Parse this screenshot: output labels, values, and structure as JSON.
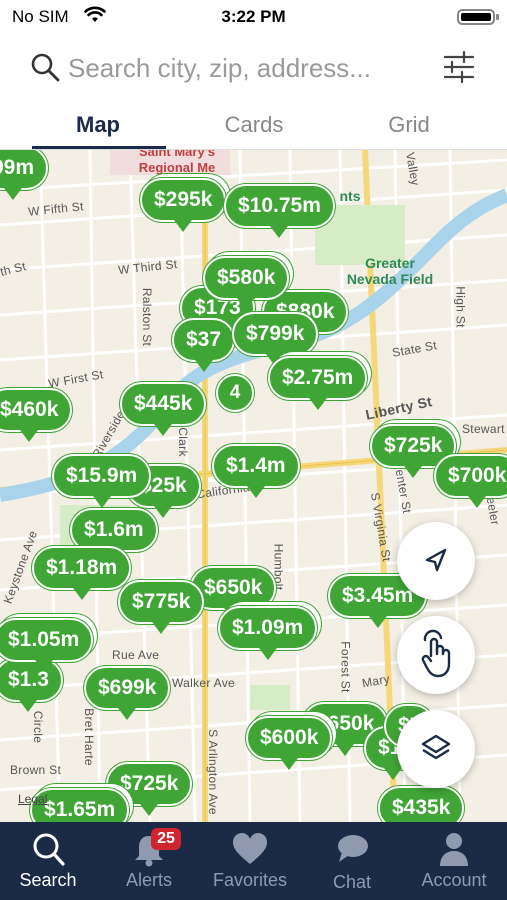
{
  "status_bar": {
    "carrier": "No SIM",
    "time": "3:22 PM"
  },
  "search": {
    "placeholder": "Search city, zip, address..."
  },
  "tabs": [
    {
      "label": "Map",
      "active": true
    },
    {
      "label": "Cards",
      "active": false
    },
    {
      "label": "Grid",
      "active": false
    }
  ],
  "map": {
    "streets": [
      "W Fifth St",
      "W Third St",
      "th St",
      "Ralston St",
      "W First St",
      "State St",
      "Keystone Ave",
      "Rue Ave",
      "Walker Ave",
      "Forest St",
      "S Virginia St",
      "S Arlington Ave",
      "Bret Harte",
      "Brown St",
      "Circle",
      "Clark",
      "Humbolt",
      "Mary",
      "Stewart St",
      "High St",
      "Valley",
      "Center St",
      "Wheeler",
      "Liberty St",
      "Riverside Dr",
      "California Ave"
    ],
    "pois": [
      "Saint Mary's Regional Me",
      "Greater Nevada Field",
      "nts"
    ],
    "pins": [
      "99m",
      "$295k",
      "$10.75m",
      "$580k",
      "$173",
      "$880k",
      "$799k",
      "$37",
      "$2.75m",
      "$460k",
      "$445k",
      "$725k",
      "$700k",
      "$15.9m",
      "$25k",
      "$1.4m",
      "$1.6m",
      "$1.18m",
      "$650k",
      "$775k",
      "$3.45m",
      "$1.05m",
      "$1.09m",
      "$1.3",
      "$699k",
      "$650k",
      "$600k",
      "$1.",
      "$7",
      "$725k",
      "$1.65m",
      "$435k"
    ],
    "cluster_count": "4",
    "legal": "Legal"
  },
  "nav": {
    "items": [
      {
        "label": "Search",
        "icon": "search-icon",
        "active": true
      },
      {
        "label": "Alerts",
        "icon": "bell-icon",
        "active": false,
        "badge": "25"
      },
      {
        "label": "Favorites",
        "icon": "heart-icon",
        "active": false
      },
      {
        "label": "Chat",
        "icon": "chat-icon",
        "active": false
      },
      {
        "label": "Account",
        "icon": "person-icon",
        "active": false
      }
    ]
  },
  "colors": {
    "pin_green": "#3fa535",
    "nav_bg": "#1b2a47",
    "badge_red": "#d0242f",
    "active_tab": "#1b2b4b"
  }
}
